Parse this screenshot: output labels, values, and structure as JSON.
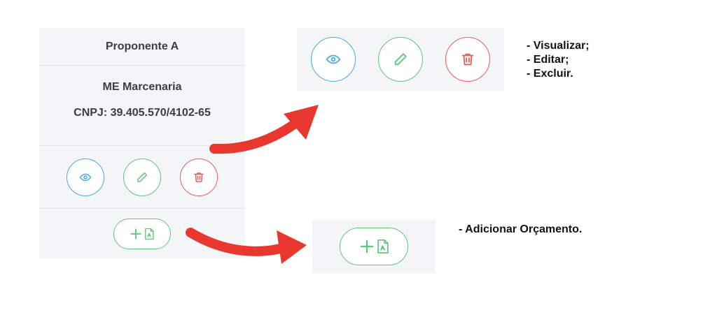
{
  "card": {
    "header_title": "Proponente A",
    "company_name": "ME Marcenaria",
    "cnpj": "CNPJ: 39.405.570/4102-65"
  },
  "icons": {
    "view": "eye-icon",
    "edit": "pencil-icon",
    "delete": "trash-icon",
    "add": "plus-icon",
    "document": "pdf-document-icon",
    "arrow": "curved-arrow-icon"
  },
  "colors": {
    "view": "#4aa9e6",
    "edit": "#5cc877",
    "delete": "#ef5a5a",
    "arrow": "#e8372f"
  },
  "legend": {
    "visualizar": "- Visualizar;",
    "editar": "- Editar;",
    "excluir": "- Excluir.",
    "adicionar": "- Adicionar Orçamento."
  }
}
